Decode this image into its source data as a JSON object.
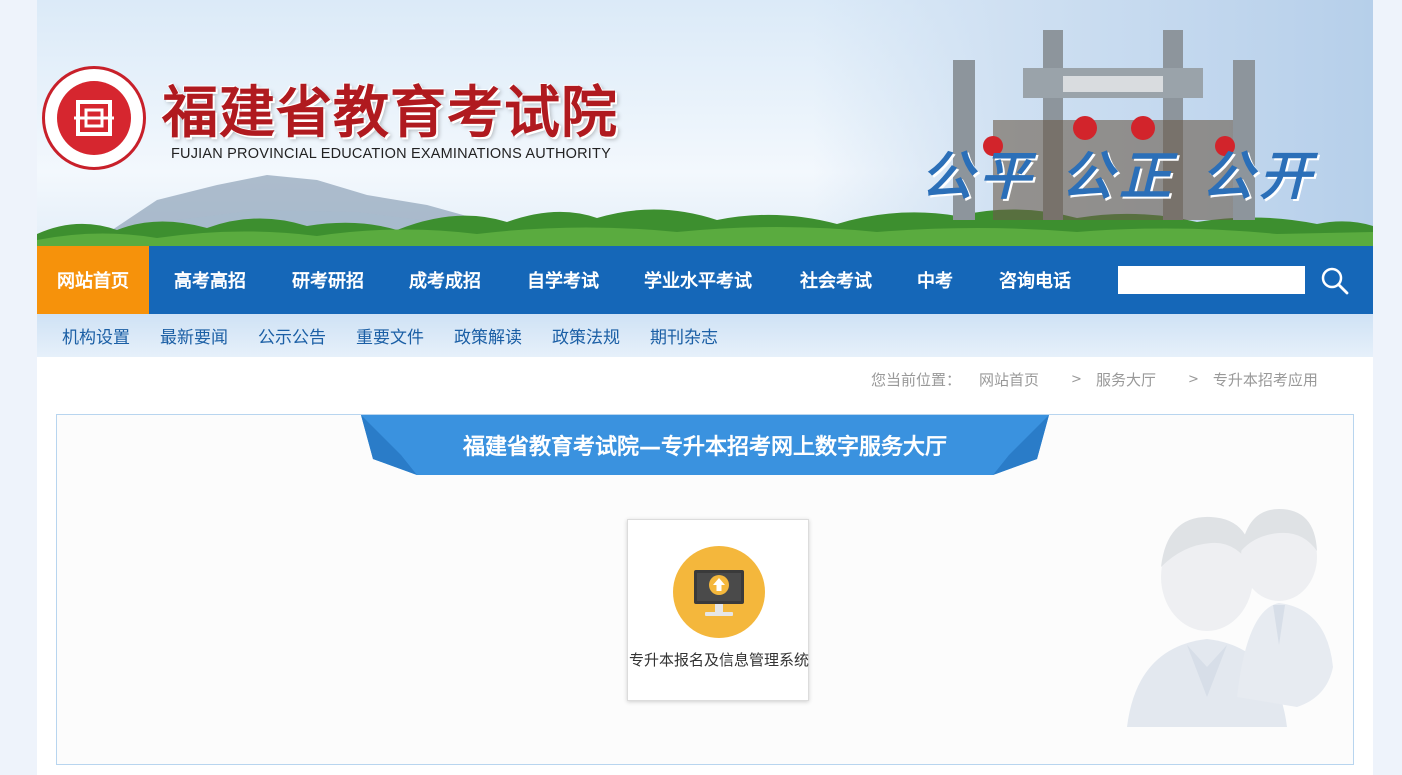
{
  "header": {
    "title_cn": "福建省教育考试院",
    "title_en": "FUJIAN PROVINCIAL EDUCATION EXAMINATIONS AUTHORITY",
    "slogan": "公平 公正 公开",
    "brand_red": "#b01a1f"
  },
  "main_nav": {
    "items": [
      {
        "label": "网站首页",
        "active": true
      },
      {
        "label": "高考高招"
      },
      {
        "label": "研考研招"
      },
      {
        "label": "成考成招"
      },
      {
        "label": "自学考试"
      },
      {
        "label": "学业水平考试"
      },
      {
        "label": "社会考试"
      },
      {
        "label": "中考"
      },
      {
        "label": "咨询电话"
      }
    ],
    "search_value": "",
    "search_icon": "search-icon",
    "bg_color": "#1567b8",
    "active_color": "#f6920b"
  },
  "sub_nav": {
    "items": [
      "机构设置",
      "最新要闻",
      "公示公告",
      "重要文件",
      "政策解读",
      "政策法规",
      "期刊杂志"
    ]
  },
  "breadcrumb": {
    "prefix": "您当前位置：",
    "items": [
      "网站首页",
      "服务大厅",
      "专升本招考应用"
    ],
    "separator": ">"
  },
  "panel": {
    "title": "福建省教育考试院—专升本招考网上数字服务大厅",
    "ribbon_color": "#3a92df"
  },
  "services": [
    {
      "label": "专升本报名及信息管理系统",
      "icon": "computer-upload-icon",
      "icon_color": "#f4b73c"
    }
  ]
}
